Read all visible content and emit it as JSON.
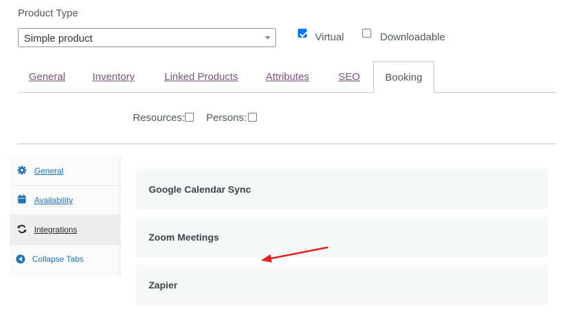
{
  "product_type": {
    "label": "Product Type",
    "selected": "Simple product",
    "virtual": {
      "label": "Virtual",
      "checked": true
    },
    "downloadable": {
      "label": "Downloadable",
      "checked": false
    }
  },
  "tabs": [
    {
      "label": "General"
    },
    {
      "label": "Inventory"
    },
    {
      "label": "Linked Products"
    },
    {
      "label": "Attributes"
    },
    {
      "label": "SEO"
    },
    {
      "label": "Booking",
      "active": true
    }
  ],
  "booking_options": {
    "resources": {
      "label": "Resources:",
      "checked": false
    },
    "persons": {
      "label": "Persons:",
      "checked": false
    }
  },
  "sidebar": {
    "items": [
      {
        "label": "General",
        "icon": "gear-icon"
      },
      {
        "label": "Availability",
        "icon": "calendar-icon"
      },
      {
        "label": "Integrations",
        "icon": "sync-icon",
        "active": true
      },
      {
        "label": "Collapse Tabs",
        "icon": "collapse-left-icon"
      }
    ]
  },
  "integrations": [
    {
      "title": "Google Calendar Sync"
    },
    {
      "title": "Zoom Meetings"
    },
    {
      "title": "Zapier"
    }
  ],
  "colors": {
    "tab_link": "#7b4f7e",
    "sidebar_link": "#2271b1",
    "checkbox_checked": "#0075ff",
    "annotation_arrow": "#e0201b"
  }
}
